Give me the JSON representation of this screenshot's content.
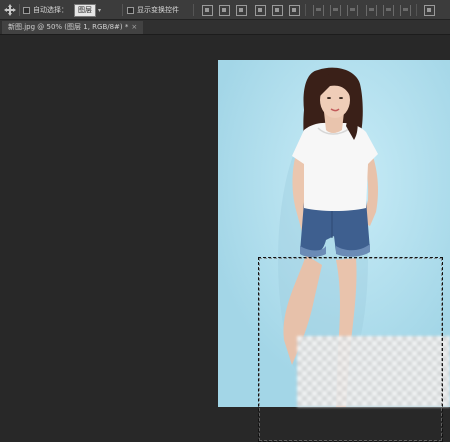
{
  "options_bar": {
    "auto_select_label": "自动选择：",
    "auto_select_value": "图层",
    "show_transform_label": "显示变换控件"
  },
  "document_tab": {
    "title": "新图.jpg @ 50% (图层 1, RGB/8#) *",
    "close_symbol": "×"
  },
  "colors": {
    "toolbar_bg": "#3c3c3c",
    "canvas_bg": "#282828",
    "photo_bg": "#b3dfee",
    "shirt": "#f7f7f7",
    "shorts": "#3e5f8f",
    "hair": "#3a2018"
  }
}
